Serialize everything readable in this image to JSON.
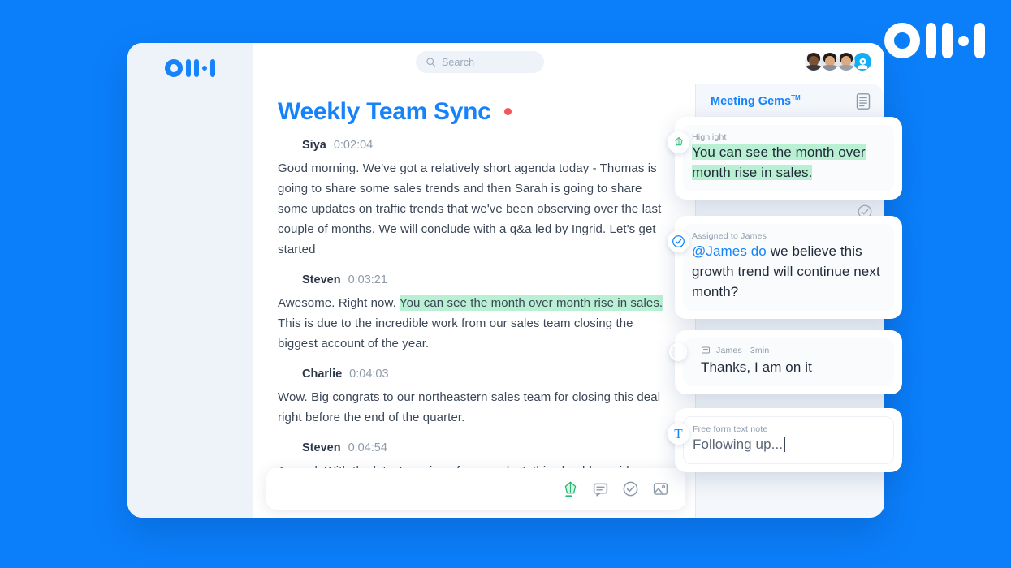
{
  "brand": {
    "name": "Otter",
    "logo_icon": "otter-waveform-logo",
    "accent": "#1683fb",
    "page_background": "#0b7ffa"
  },
  "topbar": {
    "search": {
      "icon": "search-icon",
      "placeholder": "Search",
      "value": ""
    },
    "avatars": [
      {
        "name": "avatar-participant-1"
      },
      {
        "name": "avatar-participant-2"
      },
      {
        "name": "avatar-participant-3"
      },
      {
        "name": "avatar-recorder",
        "type": "record-icon"
      }
    ]
  },
  "document": {
    "title": "Weekly Team Sync",
    "recording_indicator": {
      "icon": "recording-dot",
      "color": "#f4555a"
    },
    "utterances": [
      {
        "speaker": "Siya",
        "time": "0:02:04",
        "text": "Good morning. We've got a relatively short agenda today - Thomas is going to share some sales trends and then Sarah is going to share some updates on traffic trends that we've been observing over the last couple of months. We will conclude with a q&a led by Ingrid. Let's get started"
      },
      {
        "speaker": "Steven",
        "time": "0:03:21",
        "text_before": "Awesome. Right now. ",
        "text_highlight": "You can see the month over month rise in sales.",
        "text_after": " This is due to the incredible work from our sales team closing the biggest account of the year."
      },
      {
        "speaker": "Charlie",
        "time": "0:04:03",
        "text": "Wow. Big congrats to our northeastern sales team for closing this deal right before the end of the quarter."
      },
      {
        "speaker": "Steven",
        "time": "0:04:54",
        "text": "Agreed. With the latest version of our product, this should provide us more"
      }
    ]
  },
  "composer": {
    "placeholder": "",
    "value": "",
    "tools": [
      {
        "icon": "highlighter-gem-icon",
        "label": "Highlight"
      },
      {
        "icon": "comment-icon",
        "label": "Comment"
      },
      {
        "icon": "action-item-check-icon",
        "label": "Action item"
      },
      {
        "icon": "image-icon",
        "label": "Add image"
      }
    ]
  },
  "gems_panel": {
    "title": "Meeting Gems",
    "trademark": "TM",
    "header_icon": "notes-document-icon",
    "ghost_icon": "action-item-check-icon",
    "cards": [
      {
        "kind": "highlight",
        "badge_icon": "gem-icon",
        "label": "Highlight",
        "text": "You can see the month over month rise in sales.",
        "highlight_color": "#b9efd2"
      },
      {
        "kind": "action-item",
        "badge_icon": "action-item-check-icon",
        "label": "Assigned to James",
        "mention": "@James do",
        "text": " we believe this growth trend will continue next month?"
      },
      {
        "kind": "comment",
        "badge_icon": "avatar-james",
        "meta_icon": "comment-icon",
        "label": "James · 3min",
        "text": "Thanks, I am on it"
      },
      {
        "kind": "text-note",
        "badge_icon": "text-note-icon",
        "badge_glyph": "T",
        "label": "Free form text note",
        "text": "Following up..."
      }
    ]
  }
}
